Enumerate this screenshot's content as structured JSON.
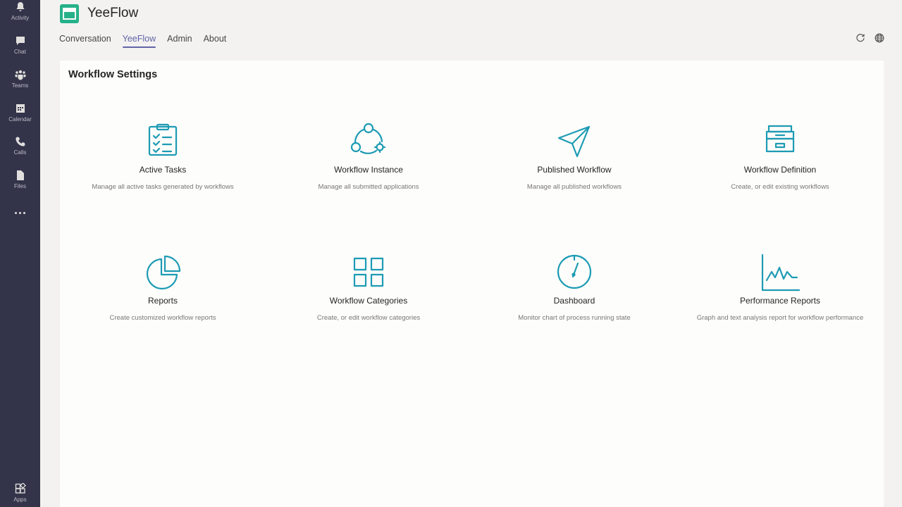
{
  "rail": {
    "items": [
      {
        "label": "Activity",
        "icon": "bell-icon"
      },
      {
        "label": "Chat",
        "icon": "chat-icon"
      },
      {
        "label": "Teams",
        "icon": "teams-icon"
      },
      {
        "label": "Calendar",
        "icon": "calendar-icon"
      },
      {
        "label": "Calls",
        "icon": "phone-icon"
      },
      {
        "label": "Files",
        "icon": "file-icon"
      }
    ],
    "apps_label": "Apps"
  },
  "header": {
    "app_name": "YeeFlow",
    "tabs": [
      {
        "label": "Conversation"
      },
      {
        "label": "YeeFlow"
      },
      {
        "label": "Admin"
      },
      {
        "label": "About"
      }
    ],
    "active_tab": "YeeFlow"
  },
  "main": {
    "title": "Workflow Settings",
    "tiles": [
      {
        "title": "Active Tasks",
        "desc": "Manage all active tasks generated by workflows",
        "icon": "clipboard-checklist-icon"
      },
      {
        "title": "Workflow Instance",
        "desc": "Manage all submitted applications",
        "icon": "workflow-instance-icon"
      },
      {
        "title": "Published Workflow",
        "desc": "Manage all published workflows",
        "icon": "paper-plane-icon"
      },
      {
        "title": "Workflow Definition",
        "desc": "Create, or edit existing workflows",
        "icon": "archive-box-icon"
      },
      {
        "title": "Reports",
        "desc": "Create customized workflow reports",
        "icon": "pie-chart-icon"
      },
      {
        "title": "Workflow Categories",
        "desc": "Create, or edit workflow categories",
        "icon": "grid-icon"
      },
      {
        "title": "Dashboard",
        "desc": "Monitor chart of process running state",
        "icon": "gauge-icon"
      },
      {
        "title": "Performance Reports",
        "desc": "Graph and text analysis report for workflow performance",
        "icon": "line-chart-icon"
      }
    ]
  },
  "colors": {
    "rail_bg": "#33344a",
    "accent": "#6264a7",
    "icon_teal": "#1d9bb4",
    "logo_green": "#27b18a"
  }
}
